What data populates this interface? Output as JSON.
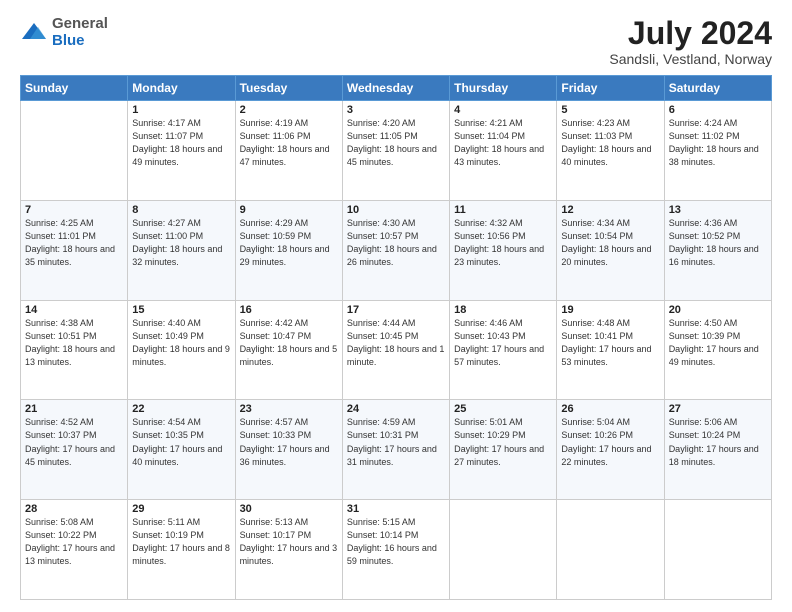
{
  "header": {
    "logo": {
      "general": "General",
      "blue": "Blue"
    },
    "title": "July 2024",
    "subtitle": "Sandsli, Vestland, Norway"
  },
  "calendar": {
    "days_of_week": [
      "Sunday",
      "Monday",
      "Tuesday",
      "Wednesday",
      "Thursday",
      "Friday",
      "Saturday"
    ],
    "weeks": [
      [
        {
          "day": "",
          "sunrise": "",
          "sunset": "",
          "daylight": ""
        },
        {
          "day": "1",
          "sunrise": "Sunrise: 4:17 AM",
          "sunset": "Sunset: 11:07 PM",
          "daylight": "Daylight: 18 hours and 49 minutes."
        },
        {
          "day": "2",
          "sunrise": "Sunrise: 4:19 AM",
          "sunset": "Sunset: 11:06 PM",
          "daylight": "Daylight: 18 hours and 47 minutes."
        },
        {
          "day": "3",
          "sunrise": "Sunrise: 4:20 AM",
          "sunset": "Sunset: 11:05 PM",
          "daylight": "Daylight: 18 hours and 45 minutes."
        },
        {
          "day": "4",
          "sunrise": "Sunrise: 4:21 AM",
          "sunset": "Sunset: 11:04 PM",
          "daylight": "Daylight: 18 hours and 43 minutes."
        },
        {
          "day": "5",
          "sunrise": "Sunrise: 4:23 AM",
          "sunset": "Sunset: 11:03 PM",
          "daylight": "Daylight: 18 hours and 40 minutes."
        },
        {
          "day": "6",
          "sunrise": "Sunrise: 4:24 AM",
          "sunset": "Sunset: 11:02 PM",
          "daylight": "Daylight: 18 hours and 38 minutes."
        }
      ],
      [
        {
          "day": "7",
          "sunrise": "Sunrise: 4:25 AM",
          "sunset": "Sunset: 11:01 PM",
          "daylight": "Daylight: 18 hours and 35 minutes."
        },
        {
          "day": "8",
          "sunrise": "Sunrise: 4:27 AM",
          "sunset": "Sunset: 11:00 PM",
          "daylight": "Daylight: 18 hours and 32 minutes."
        },
        {
          "day": "9",
          "sunrise": "Sunrise: 4:29 AM",
          "sunset": "Sunset: 10:59 PM",
          "daylight": "Daylight: 18 hours and 29 minutes."
        },
        {
          "day": "10",
          "sunrise": "Sunrise: 4:30 AM",
          "sunset": "Sunset: 10:57 PM",
          "daylight": "Daylight: 18 hours and 26 minutes."
        },
        {
          "day": "11",
          "sunrise": "Sunrise: 4:32 AM",
          "sunset": "Sunset: 10:56 PM",
          "daylight": "Daylight: 18 hours and 23 minutes."
        },
        {
          "day": "12",
          "sunrise": "Sunrise: 4:34 AM",
          "sunset": "Sunset: 10:54 PM",
          "daylight": "Daylight: 18 hours and 20 minutes."
        },
        {
          "day": "13",
          "sunrise": "Sunrise: 4:36 AM",
          "sunset": "Sunset: 10:52 PM",
          "daylight": "Daylight: 18 hours and 16 minutes."
        }
      ],
      [
        {
          "day": "14",
          "sunrise": "Sunrise: 4:38 AM",
          "sunset": "Sunset: 10:51 PM",
          "daylight": "Daylight: 18 hours and 13 minutes."
        },
        {
          "day": "15",
          "sunrise": "Sunrise: 4:40 AM",
          "sunset": "Sunset: 10:49 PM",
          "daylight": "Daylight: 18 hours and 9 minutes."
        },
        {
          "day": "16",
          "sunrise": "Sunrise: 4:42 AM",
          "sunset": "Sunset: 10:47 PM",
          "daylight": "Daylight: 18 hours and 5 minutes."
        },
        {
          "day": "17",
          "sunrise": "Sunrise: 4:44 AM",
          "sunset": "Sunset: 10:45 PM",
          "daylight": "Daylight: 18 hours and 1 minute."
        },
        {
          "day": "18",
          "sunrise": "Sunrise: 4:46 AM",
          "sunset": "Sunset: 10:43 PM",
          "daylight": "Daylight: 17 hours and 57 minutes."
        },
        {
          "day": "19",
          "sunrise": "Sunrise: 4:48 AM",
          "sunset": "Sunset: 10:41 PM",
          "daylight": "Daylight: 17 hours and 53 minutes."
        },
        {
          "day": "20",
          "sunrise": "Sunrise: 4:50 AM",
          "sunset": "Sunset: 10:39 PM",
          "daylight": "Daylight: 17 hours and 49 minutes."
        }
      ],
      [
        {
          "day": "21",
          "sunrise": "Sunrise: 4:52 AM",
          "sunset": "Sunset: 10:37 PM",
          "daylight": "Daylight: 17 hours and 45 minutes."
        },
        {
          "day": "22",
          "sunrise": "Sunrise: 4:54 AM",
          "sunset": "Sunset: 10:35 PM",
          "daylight": "Daylight: 17 hours and 40 minutes."
        },
        {
          "day": "23",
          "sunrise": "Sunrise: 4:57 AM",
          "sunset": "Sunset: 10:33 PM",
          "daylight": "Daylight: 17 hours and 36 minutes."
        },
        {
          "day": "24",
          "sunrise": "Sunrise: 4:59 AM",
          "sunset": "Sunset: 10:31 PM",
          "daylight": "Daylight: 17 hours and 31 minutes."
        },
        {
          "day": "25",
          "sunrise": "Sunrise: 5:01 AM",
          "sunset": "Sunset: 10:29 PM",
          "daylight": "Daylight: 17 hours and 27 minutes."
        },
        {
          "day": "26",
          "sunrise": "Sunrise: 5:04 AM",
          "sunset": "Sunset: 10:26 PM",
          "daylight": "Daylight: 17 hours and 22 minutes."
        },
        {
          "day": "27",
          "sunrise": "Sunrise: 5:06 AM",
          "sunset": "Sunset: 10:24 PM",
          "daylight": "Daylight: 17 hours and 18 minutes."
        }
      ],
      [
        {
          "day": "28",
          "sunrise": "Sunrise: 5:08 AM",
          "sunset": "Sunset: 10:22 PM",
          "daylight": "Daylight: 17 hours and 13 minutes."
        },
        {
          "day": "29",
          "sunrise": "Sunrise: 5:11 AM",
          "sunset": "Sunset: 10:19 PM",
          "daylight": "Daylight: 17 hours and 8 minutes."
        },
        {
          "day": "30",
          "sunrise": "Sunrise: 5:13 AM",
          "sunset": "Sunset: 10:17 PM",
          "daylight": "Daylight: 17 hours and 3 minutes."
        },
        {
          "day": "31",
          "sunrise": "Sunrise: 5:15 AM",
          "sunset": "Sunset: 10:14 PM",
          "daylight": "Daylight: 16 hours and 59 minutes."
        },
        {
          "day": "",
          "sunrise": "",
          "sunset": "",
          "daylight": ""
        },
        {
          "day": "",
          "sunrise": "",
          "sunset": "",
          "daylight": ""
        },
        {
          "day": "",
          "sunrise": "",
          "sunset": "",
          "daylight": ""
        }
      ]
    ]
  }
}
